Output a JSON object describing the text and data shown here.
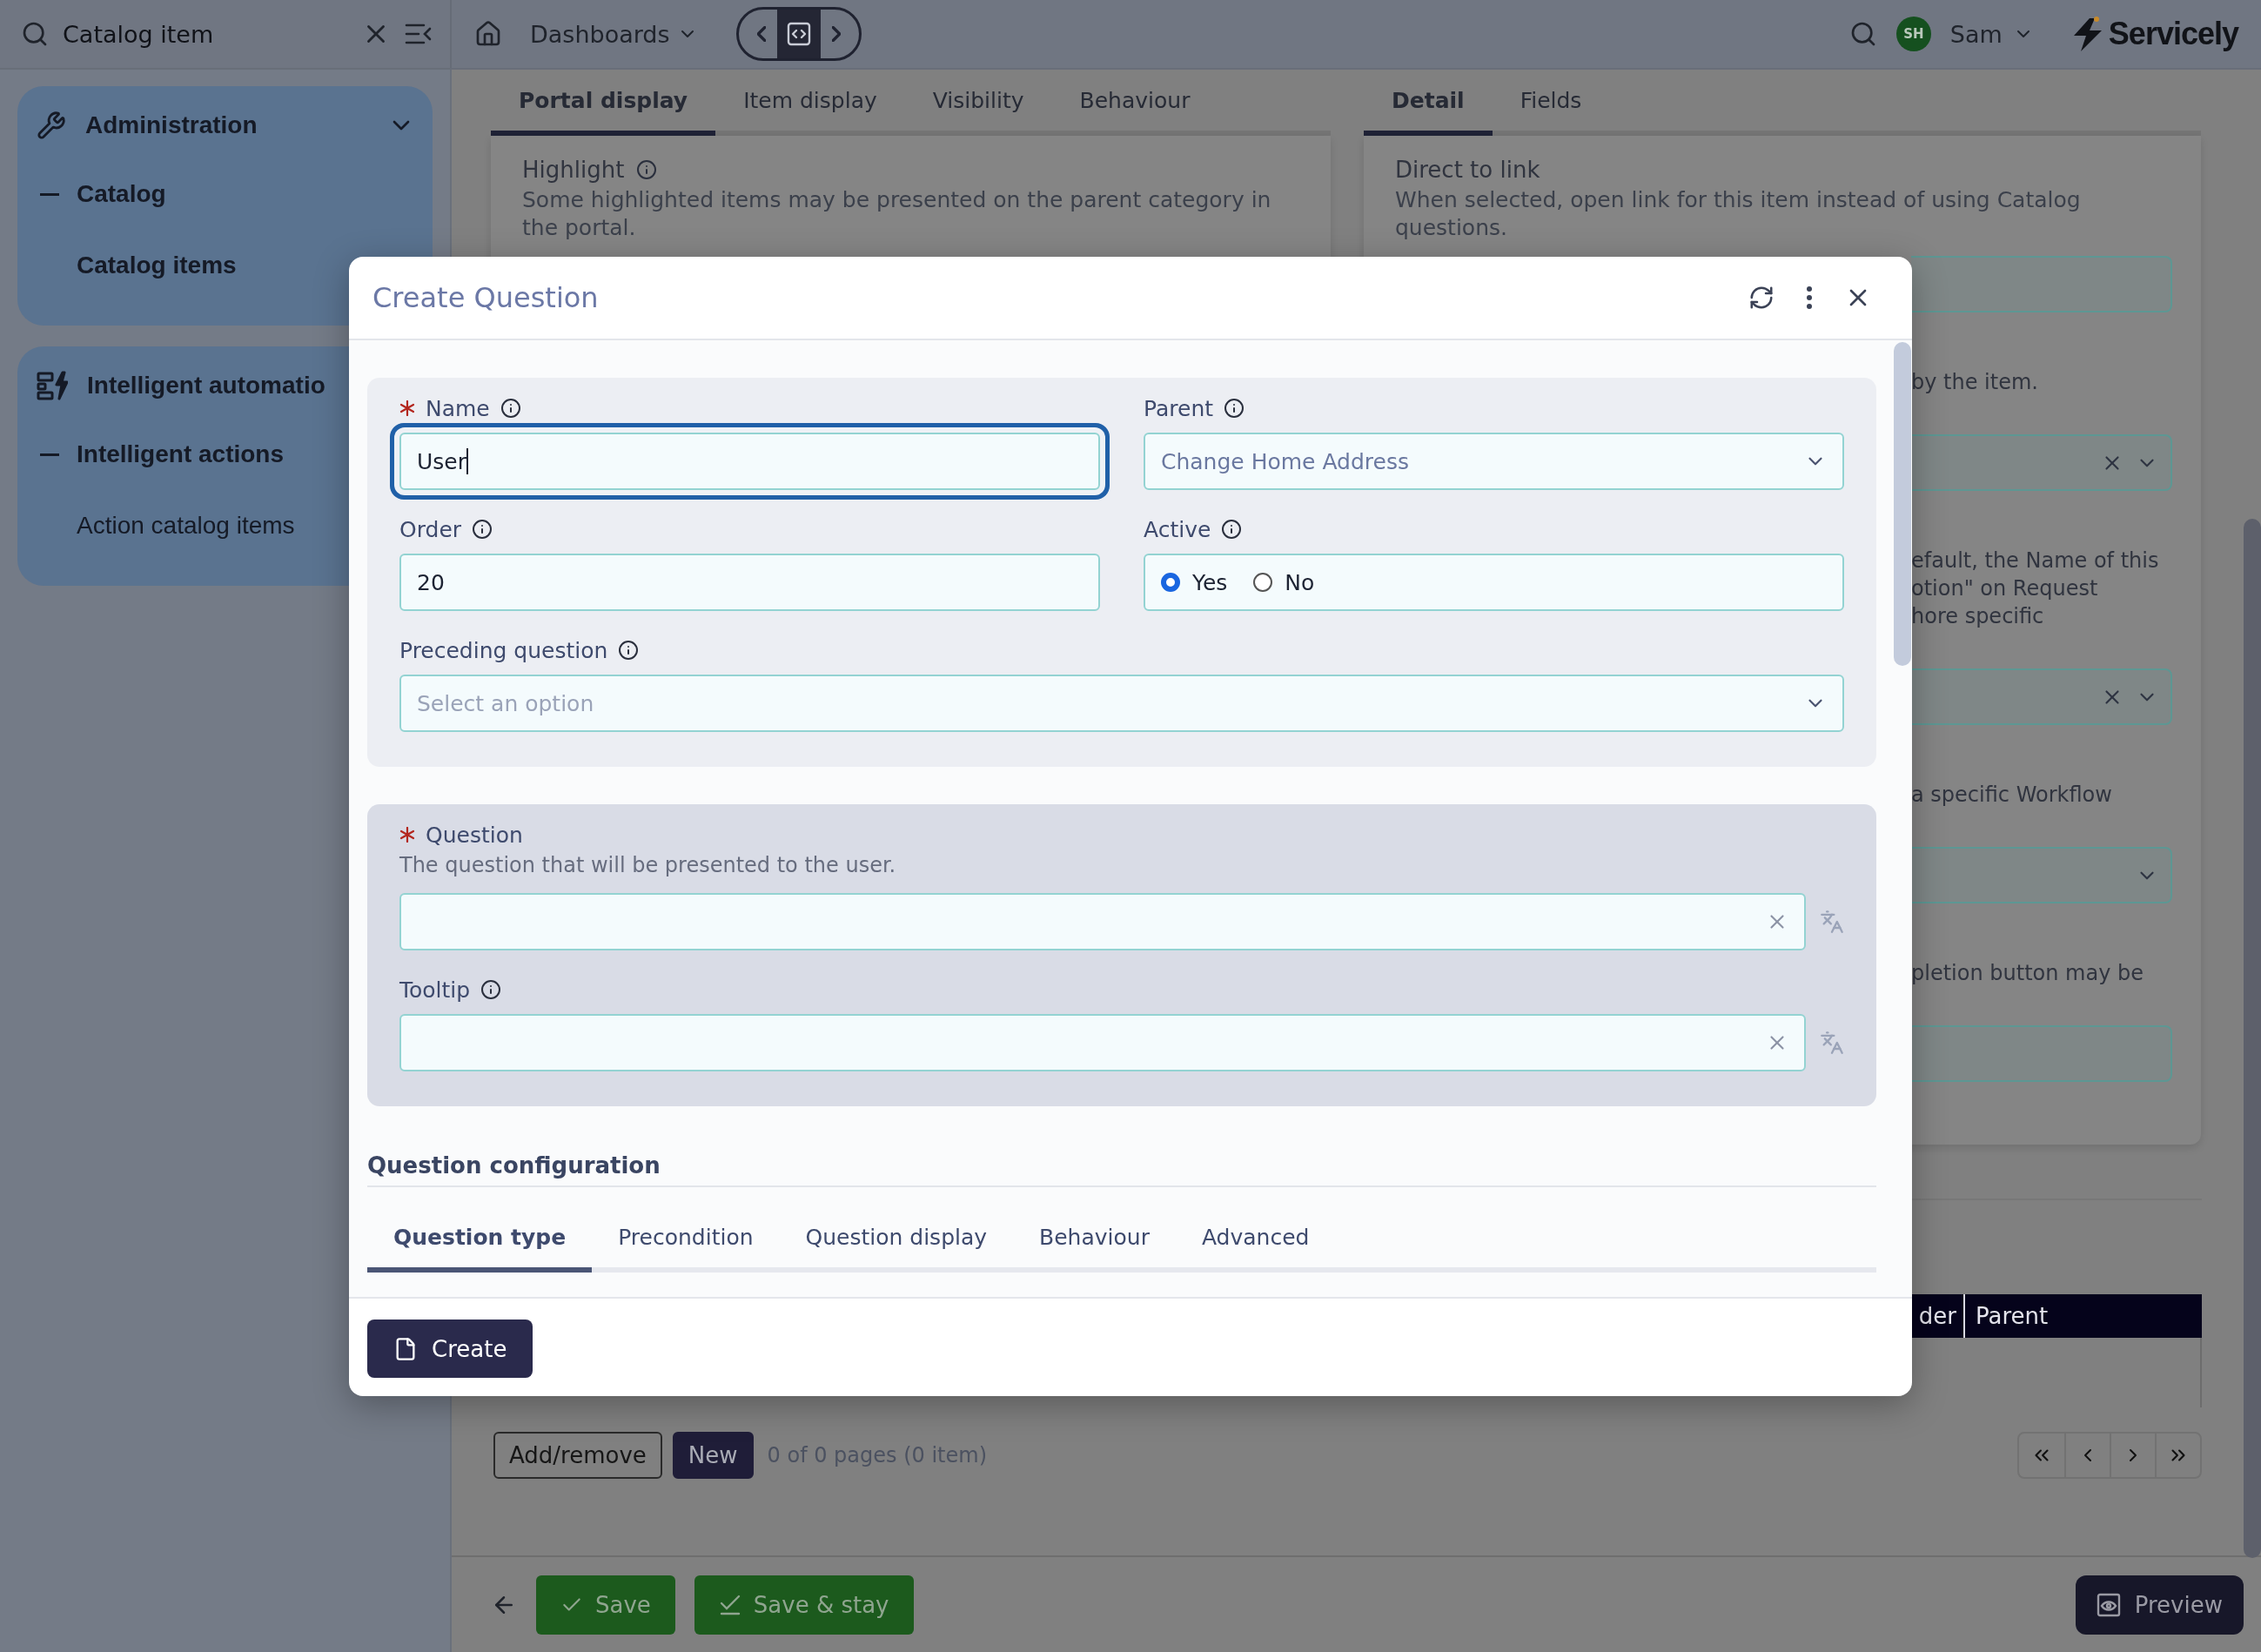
{
  "top_bar": {
    "search": {
      "value": "Catalog item"
    },
    "dashboards": "Dashboards",
    "user": {
      "initials": "SH",
      "name": "Sam"
    },
    "brand": "Servicely"
  },
  "sidebar": {
    "groups": [
      {
        "title": "Administration",
        "expanded": true,
        "items": [
          {
            "label": "Catalog",
            "kind": "section"
          },
          {
            "label": "Catalog items",
            "kind": "link",
            "selected": true
          }
        ]
      },
      {
        "title": "Intelligent automatio",
        "items": [
          {
            "label": "Intelligent actions",
            "kind": "section"
          },
          {
            "label": "Action catalog items",
            "kind": "link",
            "selected": false
          }
        ]
      }
    ]
  },
  "left_panel": {
    "tabs": [
      {
        "label": "Portal display",
        "selected": true
      },
      {
        "label": "Item display",
        "selected": false
      },
      {
        "label": "Visibility",
        "selected": false
      },
      {
        "label": "Behaviour",
        "selected": false
      }
    ],
    "card": {
      "title": "Highlight",
      "info": true,
      "description": "Some highlighted items may be presented on the parent category in the portal."
    }
  },
  "right_panel": {
    "tabs": [
      {
        "label": "Detail",
        "selected": true
      },
      {
        "label": "Fields",
        "selected": false
      }
    ],
    "card": {
      "title": "Direct to link",
      "description": "When selected, open link for this item instead of using Catalog questions.",
      "rows": [
        {
          "kind": "input"
        },
        {
          "kind": "text",
          "lines": [
            "by the item."
          ]
        },
        {
          "kind": "select",
          "clearable": true
        },
        {
          "kind": "text",
          "lines": [
            "efault, the Name of this",
            "otion\" on Request",
            "hore specific"
          ]
        },
        {
          "kind": "select",
          "clearable": true
        },
        {
          "kind": "text",
          "lines": [
            "a specific Workflow"
          ]
        },
        {
          "kind": "select",
          "clearable": false
        },
        {
          "kind": "text",
          "lines": [
            "pletion button may be"
          ]
        },
        {
          "kind": "input"
        }
      ]
    }
  },
  "table": {
    "columns": [
      "der",
      "Parent"
    ]
  },
  "list_actions": {
    "buttons": [
      {
        "label": "Add/remove",
        "kind": "outline"
      },
      {
        "label": "New",
        "kind": "primary"
      }
    ],
    "page_info": "0 of 0 pages (0 item)"
  },
  "footer": {
    "buttons": [
      {
        "label": "Save",
        "kind": "save"
      },
      {
        "label": "Save & stay",
        "kind": "stay"
      }
    ],
    "preview": "Preview"
  },
  "dialog": {
    "title": "Create Question",
    "general": {
      "name": {
        "label": "Name",
        "required": true,
        "info": true,
        "value": "User",
        "focused": true
      },
      "parent": {
        "label": "Parent",
        "info": true,
        "value": "Change Home Address"
      },
      "order": {
        "label": "Order",
        "info": true,
        "value": "20"
      },
      "active": {
        "label": "Active",
        "info": true,
        "options": [
          {
            "label": "Yes",
            "selected": true
          },
          {
            "label": "No",
            "selected": false
          }
        ]
      },
      "preceding_question": {
        "label": "Preceding question",
        "info": true,
        "placeholder": "Select an option"
      }
    },
    "question": {
      "label": "Question",
      "required": true,
      "description": "The question that will be presented to the user."
    },
    "tooltip": {
      "label": "Tooltip",
      "info": true
    },
    "configuration": {
      "heading": "Question configuration",
      "tabs": [
        {
          "label": "Question type",
          "selected": true
        },
        {
          "label": "Precondition",
          "selected": false
        },
        {
          "label": "Question display",
          "selected": false
        },
        {
          "label": "Behaviour",
          "selected": false
        },
        {
          "label": "Advanced",
          "selected": false
        }
      ]
    },
    "create_button": "Create"
  }
}
